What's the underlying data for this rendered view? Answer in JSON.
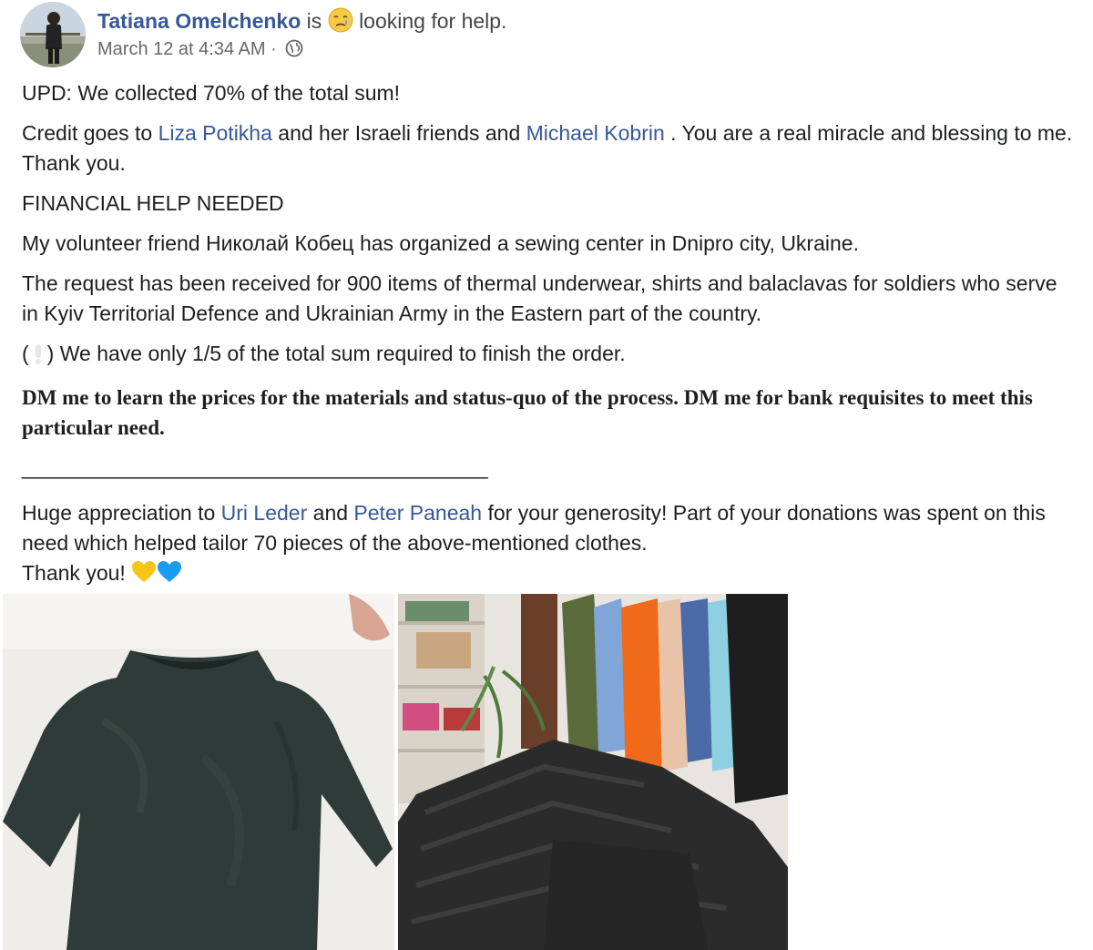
{
  "post": {
    "author": "Tatiana Omelchenko",
    "feeling_prefix": "is",
    "feeling_icon": "crying-face-emoji",
    "feeling_text": "looking for help.",
    "timestamp": "March 12 at 4:34 AM",
    "separator": "·",
    "privacy_icon": "globe-icon"
  },
  "content": {
    "p1": "UPD: We collected 70% of the total sum!",
    "p2": {
      "a": "Credit goes to ",
      "link1": "Liza Potikha",
      "b": " and her Israeli friends and ",
      "link2": "Michael Kobrin",
      "c": " . You are a real miracle and blessing to me. Thank you."
    },
    "p3": "FINANCIAL HELP NEEDED",
    "p4": "My volunteer friend Николай Кобец has organized a sewing center in Dnipro city, Ukraine.",
    "p5": "The request has been received for 900 items of thermal underwear, shirts and balaclavas for soldiers who serve in Kyiv Territorial Defence and Ukrainian Army in the Eastern part of the country.",
    "p6_open": "(",
    "p6_icon": "exclamation-icon",
    "p6_rest": ") We have only 1/5 of the total sum required to finish the order.",
    "p7": "DM me to learn the prices for the materials and status-quo of the process. DM me for bank requisites to meet this particular need.",
    "divider": "________________________________________",
    "p8": {
      "a": "Huge appreciation to ",
      "link1": "Uri Leder",
      "b": " and ",
      "link2": "Peter Paneah",
      "c": " for your generosity! Part of your donations was spent on this need which helped tailor 70 pieces of the above-mentioned clothes."
    },
    "p9": "Thank you!",
    "p9_icons": [
      "yellow-heart-icon",
      "blue-heart-icon"
    ],
    "colors": {
      "yellow_heart": "#f5c518",
      "blue_heart": "#1d9bf0",
      "link": "#365899"
    }
  },
  "photos": [
    {
      "name": "dark-green-thermal-shirt-photo"
    },
    {
      "name": "stacked-clothes-and-rack-photo"
    }
  ]
}
